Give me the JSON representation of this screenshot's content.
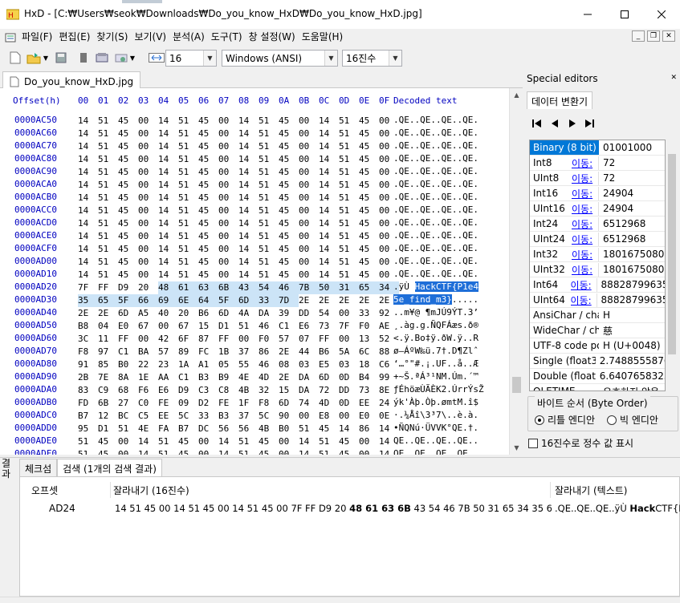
{
  "window": {
    "app_name": "HxD",
    "title": "HxD - [C:₩Users₩seok₩Downloads₩Do_you_know_HxD₩Do_you_know_HxD.jpg]",
    "desktop_peek": "Desktop"
  },
  "menu": [
    {
      "label": "파일(F)"
    },
    {
      "label": "편집(E)"
    },
    {
      "label": "찾기(S)"
    },
    {
      "label": "보기(V)"
    },
    {
      "label": "분석(A)"
    },
    {
      "label": "도구(T)"
    },
    {
      "label": "창 설정(W)"
    },
    {
      "label": "도움말(H)"
    }
  ],
  "toolbar": {
    "bytes_per_row": "16",
    "charset": "Windows (ANSI)",
    "offset_base": "16진수"
  },
  "document_tab": {
    "label": "Do_you_know_HxD.jpg"
  },
  "hex_editor": {
    "header": "Offset(h) 00 01 02 03 04 05 06 07 08 09 0A 0B 0C 0D 0E 0F  Decoded text",
    "header_offset": "Offset(h)",
    "header_columns": [
      "00",
      "01",
      "02",
      "03",
      "04",
      "05",
      "06",
      "07",
      "08",
      "09",
      "0A",
      "0B",
      "0C",
      "0D",
      "0E",
      "0F"
    ],
    "header_decoded": "Decoded text",
    "rows": [
      {
        "offset": "0000AC50",
        "bytes": [
          "14",
          "51",
          "45",
          "00",
          "14",
          "51",
          "45",
          "00",
          "14",
          "51",
          "45",
          "00",
          "14",
          "51",
          "45",
          "00"
        ],
        "text": ".QE..QE..QE..QE."
      },
      {
        "offset": "0000AC60",
        "bytes": [
          "14",
          "51",
          "45",
          "00",
          "14",
          "51",
          "45",
          "00",
          "14",
          "51",
          "45",
          "00",
          "14",
          "51",
          "45",
          "00"
        ],
        "text": ".QE..QE..QE..QE."
      },
      {
        "offset": "0000AC70",
        "bytes": [
          "14",
          "51",
          "45",
          "00",
          "14",
          "51",
          "45",
          "00",
          "14",
          "51",
          "45",
          "00",
          "14",
          "51",
          "45",
          "00"
        ],
        "text": ".QE..QE..QE..QE."
      },
      {
        "offset": "0000AC80",
        "bytes": [
          "14",
          "51",
          "45",
          "00",
          "14",
          "51",
          "45",
          "00",
          "14",
          "51",
          "45",
          "00",
          "14",
          "51",
          "45",
          "00"
        ],
        "text": ".QE..QE..QE..QE."
      },
      {
        "offset": "0000AC90",
        "bytes": [
          "14",
          "51",
          "45",
          "00",
          "14",
          "51",
          "45",
          "00",
          "14",
          "51",
          "45",
          "00",
          "14",
          "51",
          "45",
          "00"
        ],
        "text": ".QE..QE..QE..QE."
      },
      {
        "offset": "0000ACA0",
        "bytes": [
          "14",
          "51",
          "45",
          "00",
          "14",
          "51",
          "45",
          "00",
          "14",
          "51",
          "45",
          "00",
          "14",
          "51",
          "45",
          "00"
        ],
        "text": ".QE..QE..QE..QE."
      },
      {
        "offset": "0000ACB0",
        "bytes": [
          "14",
          "51",
          "45",
          "00",
          "14",
          "51",
          "45",
          "00",
          "14",
          "51",
          "45",
          "00",
          "14",
          "51",
          "45",
          "00"
        ],
        "text": ".QE..QE..QE..QE."
      },
      {
        "offset": "0000ACC0",
        "bytes": [
          "14",
          "51",
          "45",
          "00",
          "14",
          "51",
          "45",
          "00",
          "14",
          "51",
          "45",
          "00",
          "14",
          "51",
          "45",
          "00"
        ],
        "text": ".QE..QE..QE..QE."
      },
      {
        "offset": "0000ACD0",
        "bytes": [
          "14",
          "51",
          "45",
          "00",
          "14",
          "51",
          "45",
          "00",
          "14",
          "51",
          "45",
          "00",
          "14",
          "51",
          "45",
          "00"
        ],
        "text": ".QE..QE..QE..QE."
      },
      {
        "offset": "0000ACE0",
        "bytes": [
          "14",
          "51",
          "45",
          "00",
          "14",
          "51",
          "45",
          "00",
          "14",
          "51",
          "45",
          "00",
          "14",
          "51",
          "45",
          "00"
        ],
        "text": ".QE..QE..QE..QE."
      },
      {
        "offset": "0000ACF0",
        "bytes": [
          "14",
          "51",
          "45",
          "00",
          "14",
          "51",
          "45",
          "00",
          "14",
          "51",
          "45",
          "00",
          "14",
          "51",
          "45",
          "00"
        ],
        "text": ".QE..QE..QE..QE."
      },
      {
        "offset": "0000AD00",
        "bytes": [
          "14",
          "51",
          "45",
          "00",
          "14",
          "51",
          "45",
          "00",
          "14",
          "51",
          "45",
          "00",
          "14",
          "51",
          "45",
          "00"
        ],
        "text": ".QE..QE..QE..QE."
      },
      {
        "offset": "0000AD10",
        "bytes": [
          "14",
          "51",
          "45",
          "00",
          "14",
          "51",
          "45",
          "00",
          "14",
          "51",
          "45",
          "00",
          "14",
          "51",
          "45",
          "00"
        ],
        "text": ".QE..QE..QE..QE."
      },
      {
        "offset": "0000AD20",
        "bytes": [
          "7F",
          "FF",
          "D9",
          "20",
          "48",
          "61",
          "63",
          "6B",
          "43",
          "54",
          "46",
          "7B",
          "50",
          "31",
          "65",
          "34"
        ],
        "text": ".ÿÙ HackCTF{P1e4"
      },
      {
        "offset": "0000AD30",
        "bytes": [
          "35",
          "65",
          "5F",
          "66",
          "69",
          "6E",
          "64",
          "5F",
          "6D",
          "33",
          "7D",
          "2E",
          "2E",
          "2E",
          "2E",
          "2E"
        ],
        "text": "5e_find_m3}....."
      },
      {
        "offset": "0000AD40",
        "bytes": [
          "2E",
          "2E",
          "6D",
          "A5",
          "40",
          "20",
          "B6",
          "6D",
          "4A",
          "DA",
          "39",
          "DD",
          "54",
          "00",
          "33",
          "92"
        ],
        "text": "..m¥@ ¶mJÚ9ÝT.3’"
      },
      {
        "offset": "0000AD50",
        "bytes": [
          "B8",
          "04",
          "E0",
          "67",
          "00",
          "67",
          "15",
          "D1",
          "51",
          "46",
          "C1",
          "E6",
          "73",
          "7F",
          "F0",
          "AE"
        ],
        "text": "¸.àg.g.ÑQFÁæs.ð®"
      },
      {
        "offset": "0000AD60",
        "bytes": [
          "3C",
          "11",
          "FF",
          "00",
          "42",
          "6F",
          "87",
          "FF",
          "00",
          "F0",
          "57",
          "07",
          "FF",
          "00",
          "13",
          "52"
        ],
        "text": "<.ÿ.Bo‡ÿ.ðW.ÿ..R"
      },
      {
        "offset": "0000AD70",
        "bytes": [
          "F8",
          "97",
          "C1",
          "BA",
          "57",
          "89",
          "FC",
          "1B",
          "37",
          "86",
          "2E",
          "44",
          "B6",
          "5A",
          "6C",
          "88"
        ],
        "text": "ø—ÁºW‰ü.7†.D¶Zlˆ"
      },
      {
        "offset": "0000AD80",
        "bytes": [
          "91",
          "85",
          "B0",
          "22",
          "23",
          "1A",
          "A1",
          "05",
          "55",
          "46",
          "08",
          "03",
          "E5",
          "03",
          "18",
          "C6"
        ],
        "text": "‘…°\"#.¡.UF..å..Æ"
      },
      {
        "offset": "0000AD90",
        "bytes": [
          "2B",
          "7E",
          "8A",
          "1E",
          "AA",
          "C1",
          "B3",
          "B9",
          "4E",
          "4D",
          "2E",
          "DA",
          "6D",
          "0D",
          "B4",
          "99"
        ],
        "text": "+~Š.ªÁ³¹NM.Úm.´™"
      },
      {
        "offset": "0000ADA0",
        "bytes": [
          "83",
          "C9",
          "68",
          "F6",
          "E6",
          "D9",
          "C3",
          "C8",
          "4B",
          "32",
          "15",
          "DA",
          "72",
          "DD",
          "73",
          "8E"
        ],
        "text": "ƒÉhöæÙÃÈK2.ÚrrÝsŽ"
      },
      {
        "offset": "0000ADB0",
        "bytes": [
          "FD",
          "6B",
          "27",
          "C0",
          "FE",
          "09",
          "D2",
          "FE",
          "1F",
          "F8",
          "6D",
          "74",
          "4D",
          "0D",
          "EE",
          "24"
        ],
        "text": "ýk'Àþ.Òþ.ømtM.î$"
      },
      {
        "offset": "0000ADC0",
        "bytes": [
          "B7",
          "12",
          "BC",
          "C5",
          "EE",
          "5C",
          "33",
          "B3",
          "37",
          "5C",
          "90",
          "00",
          "E8",
          "00",
          "E0",
          "0E"
        ],
        "text": "·.¼Åî\\3³7\\..è.à."
      },
      {
        "offset": "0000ADD0",
        "bytes": [
          "95",
          "D1",
          "51",
          "4E",
          "FA",
          "B7",
          "DC",
          "56",
          "56",
          "4B",
          "B0",
          "51",
          "45",
          "14",
          "86",
          "14"
        ],
        "text": "•ÑQNú·ÜVVK°QE.†."
      },
      {
        "offset": "0000ADE0",
        "bytes": [
          "51",
          "45",
          "00",
          "14",
          "51",
          "45",
          "00",
          "14",
          "51",
          "45",
          "00",
          "14",
          "51",
          "45",
          "00",
          "14"
        ],
        "text": "QE..QE..QE..QE.."
      },
      {
        "offset": "0000ADF0",
        "bytes": [
          "51",
          "45",
          "00",
          "14",
          "51",
          "45",
          "00",
          "14",
          "51",
          "45",
          "00",
          "14",
          "51",
          "45",
          "00",
          "14"
        ],
        "text": "QE..QE..QE..QE.."
      }
    ]
  },
  "special_editors": {
    "header": "Special editors",
    "tab": "데이터 변환기",
    "nav": [
      "first-icon",
      "prev-icon",
      "next-icon",
      "last-icon"
    ],
    "rows": [
      {
        "type": "Binary (8 bit)",
        "link": "",
        "value": "01001000",
        "active": true
      },
      {
        "type": "Int8",
        "link": "이동:",
        "value": "72"
      },
      {
        "type": "UInt8",
        "link": "이동:",
        "value": "72"
      },
      {
        "type": "Int16",
        "link": "이동:",
        "value": "24904"
      },
      {
        "type": "UInt16",
        "link": "이동:",
        "value": "24904"
      },
      {
        "type": "Int24",
        "link": "이동:",
        "value": "6512968"
      },
      {
        "type": "UInt24",
        "link": "이동:",
        "value": "6512968"
      },
      {
        "type": "Int32",
        "link": "이동:",
        "value": "1801675080"
      },
      {
        "type": "UInt32",
        "link": "이동:",
        "value": "1801675080"
      },
      {
        "type": "Int64",
        "link": "이동:",
        "value": "88828799635"
      },
      {
        "type": "UInt64",
        "link": "이동:",
        "value": "88828799635"
      },
      {
        "type": "AnsiChar / cha",
        "link": "",
        "value": "H"
      },
      {
        "type": "WideChar / cha",
        "link": "",
        "value": "慈"
      },
      {
        "type": "UTF-8 code po",
        "link": "",
        "value": "H (U+0048)"
      },
      {
        "type": "Single (float32",
        "link": "",
        "value": "2.7488555876"
      },
      {
        "type": "Double (float64",
        "link": "",
        "value": "6.6407658325"
      },
      {
        "type": "OLETIME",
        "link": "",
        "value": "유효하지 않음"
      }
    ],
    "byte_order_label": "바이트 순서 (Byte Order)",
    "little_endian": "리틀 엔디안",
    "big_endian": "빅 엔디안",
    "hex_int_label": "16진수로 정수 값 표시"
  },
  "results": {
    "side_label": "결과",
    "tabs": [
      "체크섬",
      "검색 (1개의 검색 결과)"
    ],
    "columns": [
      "오프셋",
      "잘라내기 (16진수)",
      "잘라내기 (텍스트)"
    ],
    "row": {
      "offset": "AD24",
      "hex_before": "14 51 45 00 14 51 45 00 14 51 45 00 7F FF D9 20 ",
      "hex_match": "48 61 63 6B",
      "hex_after": " 43 54 46 7B 50 31 65 34 35 6",
      "text_before": ".QE..QE..QE..ÿÙ ",
      "text_match": "Hack",
      "text_after": "CTF{P1e"
    }
  },
  "colors": {
    "offset_blue": "#0000c0",
    "selection_light": "#cce4f7",
    "selection_dark": "#1e6ed8",
    "accent": "#0078d7"
  }
}
